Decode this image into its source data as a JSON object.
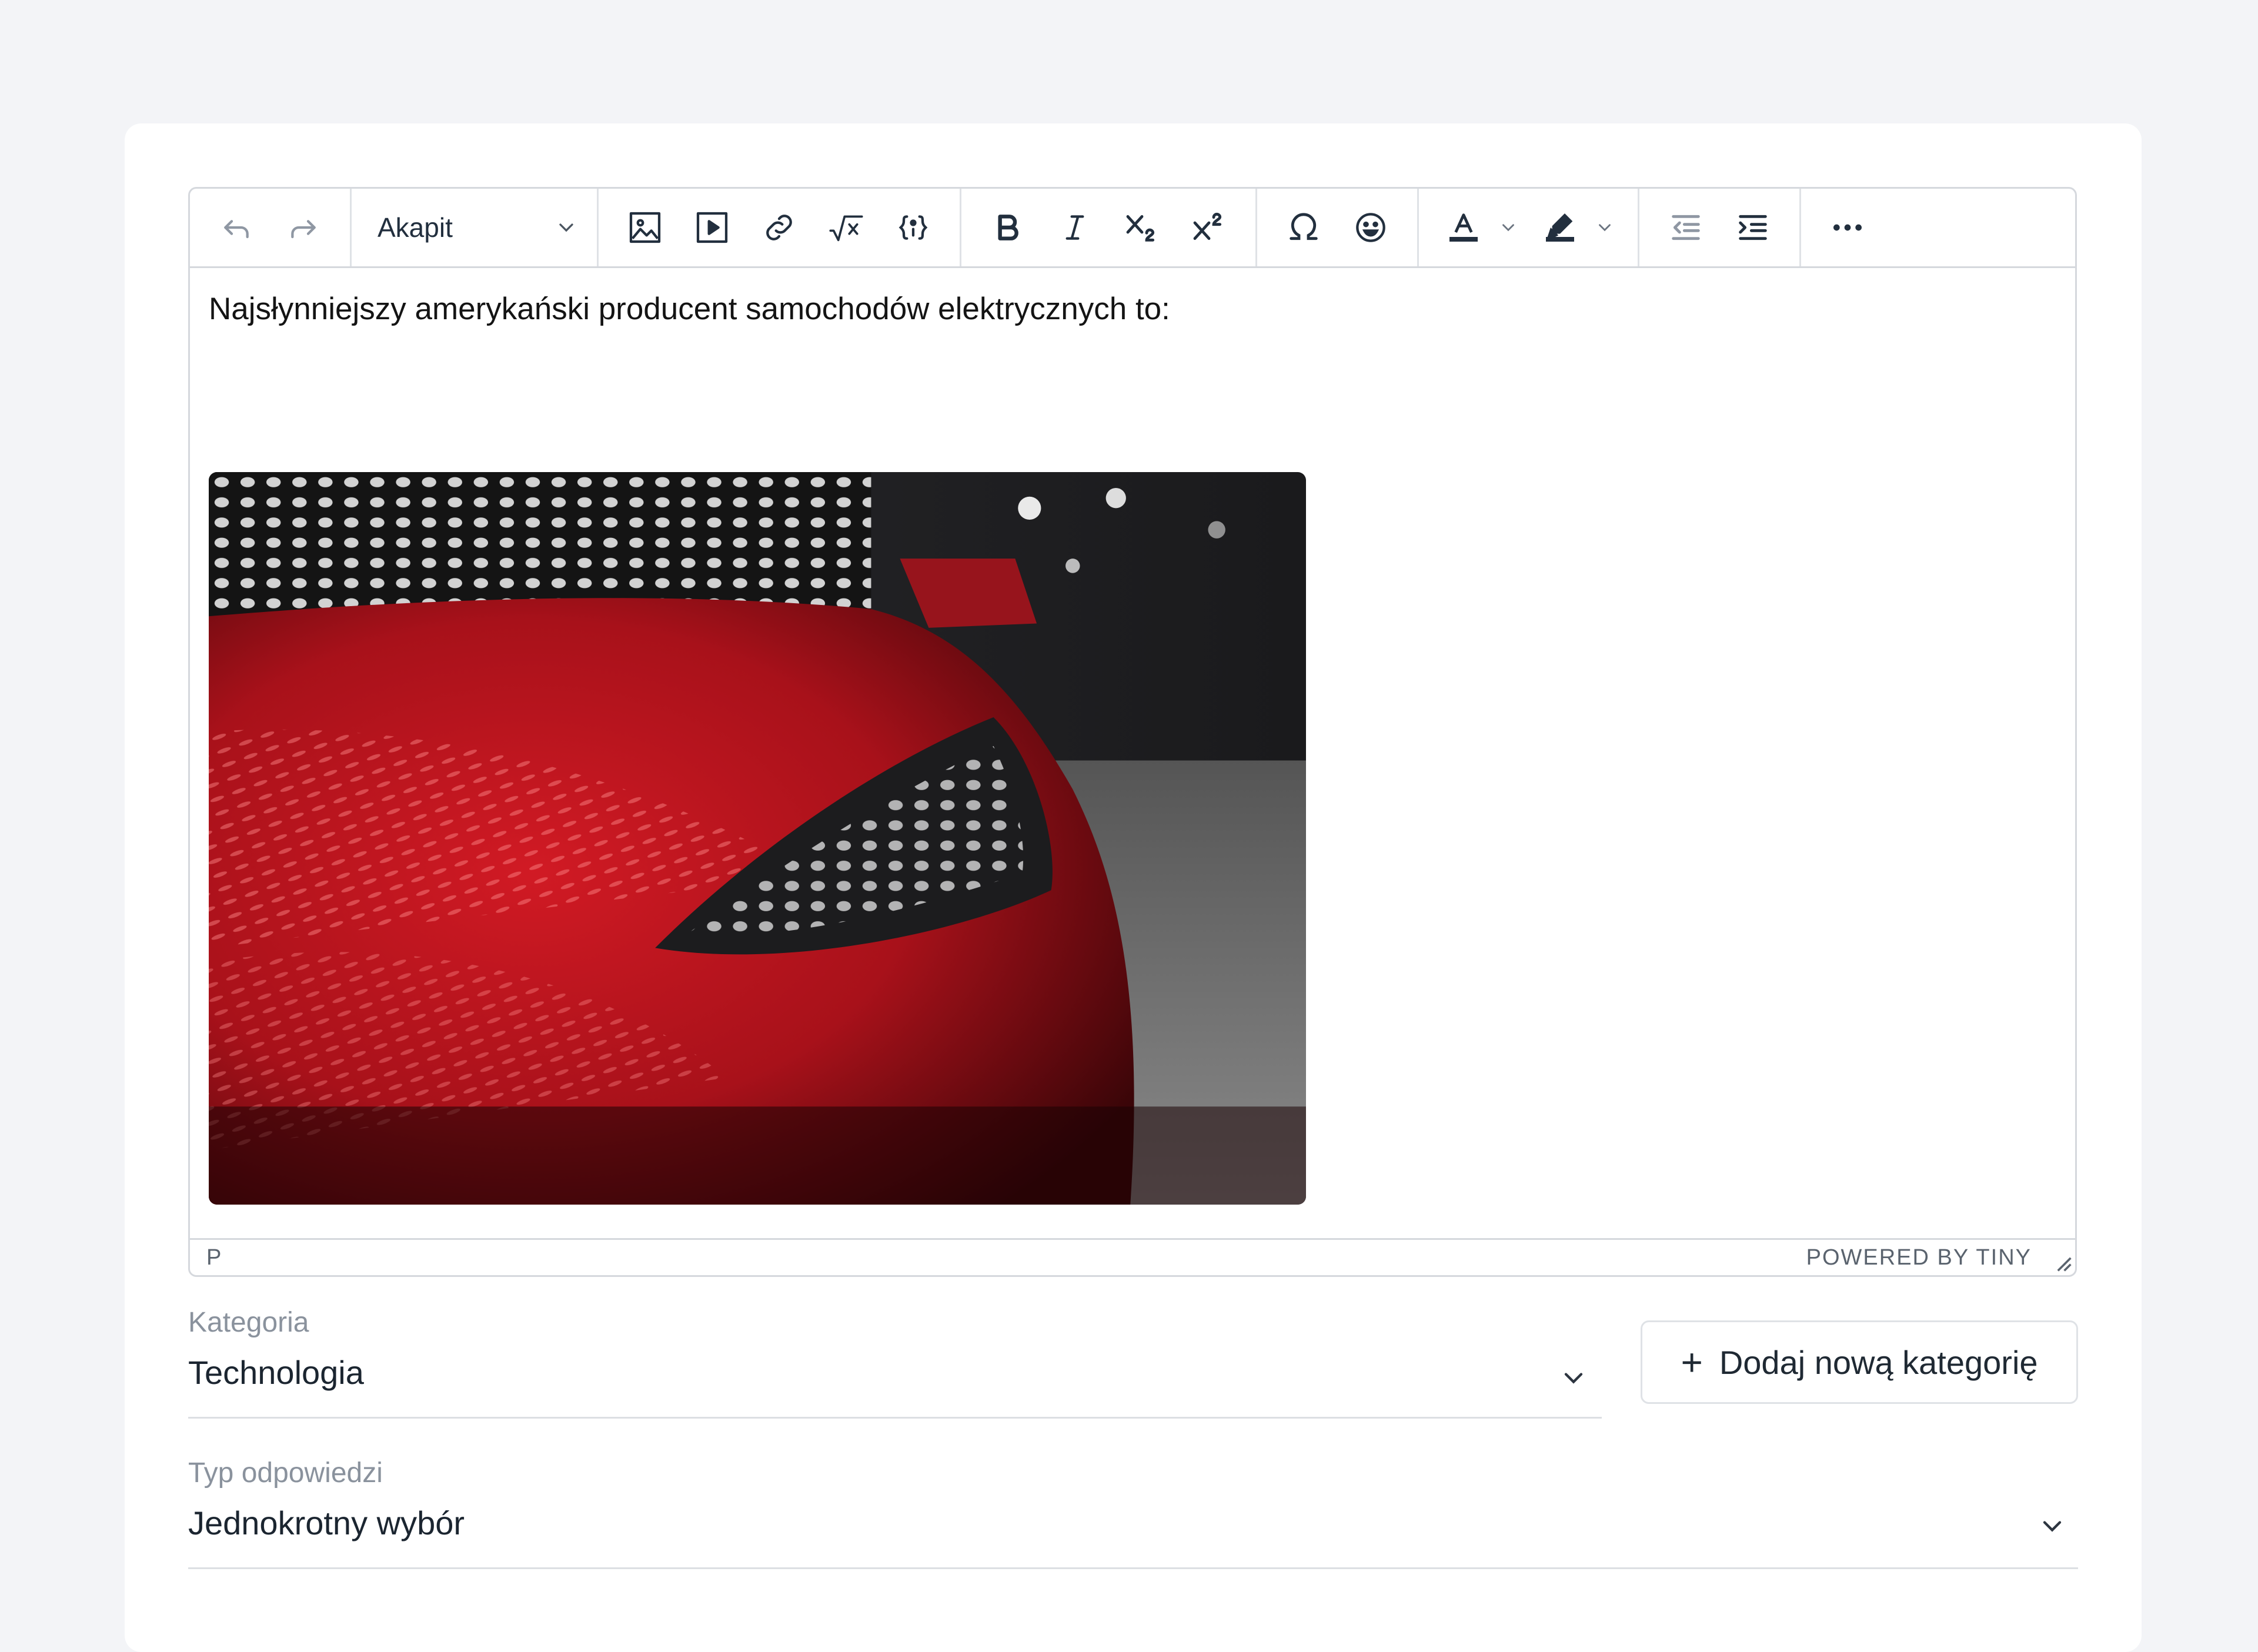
{
  "toolbar": {
    "format_value": "Akapit",
    "buttons": [
      "undo-icon",
      "redo-icon",
      "image-icon",
      "media-icon",
      "link-icon",
      "math-icon",
      "code-sample-icon",
      "bold-icon",
      "italic-icon",
      "subscript-icon",
      "superscript-icon",
      "special-char-icon",
      "emoji-icon",
      "text-color-icon",
      "highlight-icon",
      "outdent-icon",
      "indent-icon",
      "more-icon"
    ]
  },
  "editor": {
    "paragraph": "Najsłynniejszy amerykański producent samochodów elektrycznych to:",
    "image_description": "red car headlight",
    "status_path": "P",
    "powered_by": "POWERED BY TINY"
  },
  "category": {
    "label": "Kategoria",
    "value": "Technologia",
    "add_button": "Dodaj nową kategorię",
    "add_icon": "+"
  },
  "answer_type": {
    "label": "Typ odpowiedzi",
    "value": "Jednokrotny wybór"
  },
  "colors": {
    "page_bg": "#f3f4f7",
    "border": "#d5d8dd",
    "car_red": "#b5121b"
  }
}
